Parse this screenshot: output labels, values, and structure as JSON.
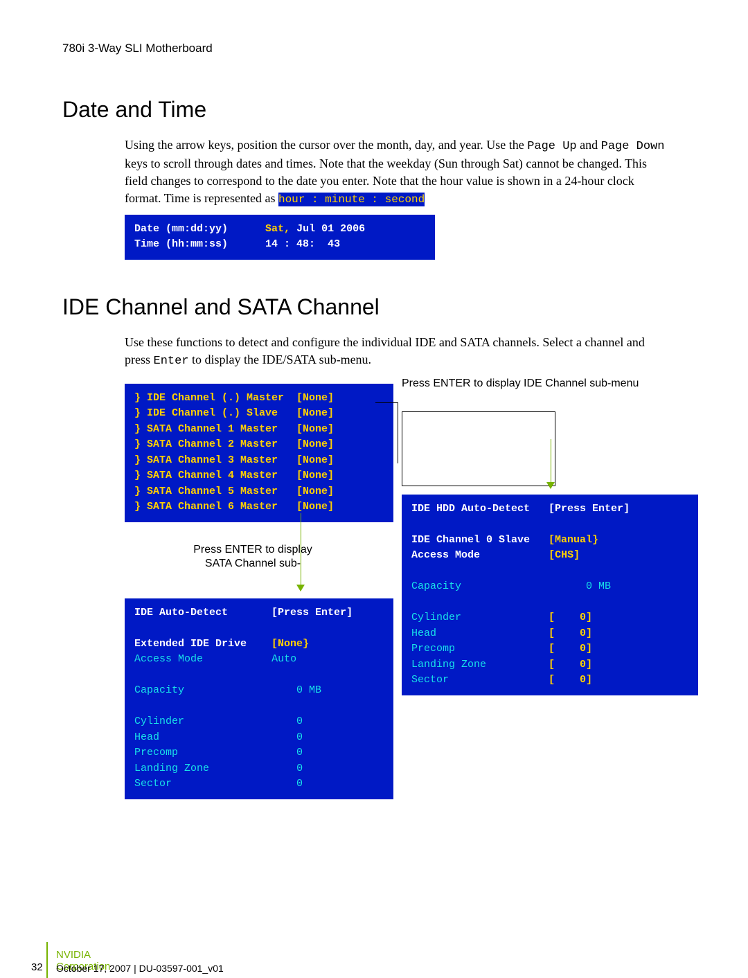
{
  "header": "780i 3-Way SLI Motherboard",
  "section1": {
    "heading": "Date and Time",
    "para_pre": "Using the arrow keys, position the cursor over the month, day, and year. Use the ",
    "mono1": "Page Up",
    "para_mid1": " and ",
    "mono2": "Page Down",
    "para_mid2": " keys to scroll through dates and times. Note that the weekday (Sun through Sat) cannot be changed. This field changes to correspond to the date you enter. Note that the hour value is shown in a 24-hour clock format. Time is represented as ",
    "inline_hl": "hour : minute : second",
    "bios": {
      "l1a": "Date (mm:dd:yy)",
      "l1b": "Sat,",
      "l1c": " Jul 01 2006",
      "l2a": "Time (hh:mm:ss)",
      "l2b": "14 : 48:  43"
    }
  },
  "section2": {
    "heading": "IDE Channel and SATA Channel",
    "para_pre": "Use these functions to detect and configure the individual IDE and SATA channels. Select a channel and press ",
    "mono1": "Enter",
    "para_post": " to display the IDE/SATA sub-menu.",
    "labels": {
      "press_ide": "Press ENTER to display IDE Channel sub-menu",
      "press_sata": "Press ENTER to display SATA Channel sub-"
    },
    "chan_list": {
      "l1": "} IDE Channel (.) Master  [None]",
      "l2": "} IDE Channel (.) Slave   [None]",
      "l3": "} SATA Channel 1 Master   [None]",
      "l4": "} SATA Channel 2 Master   [None]",
      "l5": "} SATA Channel 3 Master   [None]",
      "l6": "} SATA Channel 4 Master   [None]",
      "l7": "} SATA Channel 5 Master   [None]",
      "l8": "} SATA Channel 6 Master   [None]"
    },
    "sata_sub": {
      "l1a": "IDE Auto-Detect",
      "l1b": "[Press Enter]",
      "l3a": "Extended IDE Drive",
      "l3b": "[None}",
      "l4a": "Access Mode",
      "l4b": "Auto",
      "l6a": "Capacity",
      "l6b": "  0 MB",
      "l8a": "Cylinder",
      "l8b": "  0",
      "l9a": "Head",
      "l9b": "  0",
      "l10a": "Precomp",
      "l10b": "  0",
      "l11a": "Landing Zone",
      "l11b": "  0",
      "l12a": "Sector",
      "l12b": "  0"
    },
    "ide_sub": {
      "l1a": "IDE HDD Auto-Detect",
      "l1b": "[Press Enter]",
      "l3a": "IDE Channel 0 Slave",
      "l3b": "[Manual}",
      "l4a": "Access Mode",
      "l4b": "[CHS]",
      "l6a": "Capacity",
      "l6b": "   0 MB",
      "l8a": "Cylinder",
      "l8b": "[    0]",
      "l9a": "Head",
      "l9b": "[    0]",
      "l10a": "Precomp",
      "l10b": "[    0]",
      "l11a": "Landing Zone",
      "l11b": "[    0]",
      "l12a": "Sector",
      "l12b": "[    0]"
    }
  },
  "footer": {
    "page": "32",
    "corp": "NVIDIA Corporation",
    "date": "October 17, 2007  |  DU-03597-001_v01"
  }
}
